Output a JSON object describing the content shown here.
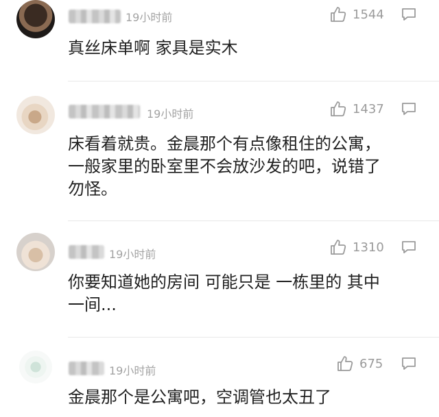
{
  "comments": [
    {
      "time": "19小时前",
      "likes": "1544",
      "text": "真丝床单啊 家具是实木"
    },
    {
      "time": "19小时前",
      "likes": "1437",
      "text": "床看着就贵。金晨那个有点像租住的公寓，\n一般家里的卧室里不会放沙发的吧，说错了\n勿怪。"
    },
    {
      "time": "19小时前",
      "likes": "1310",
      "text": "你要知道她的房间 可能只是 一栋里的 其中\n一间..."
    },
    {
      "time": "19小时前",
      "likes": "675",
      "text": "金晨那个是公寓吧，空调管也太丑了"
    }
  ],
  "icons": {
    "like": "thumbs-up-icon",
    "reply": "speech-bubble-icon"
  }
}
